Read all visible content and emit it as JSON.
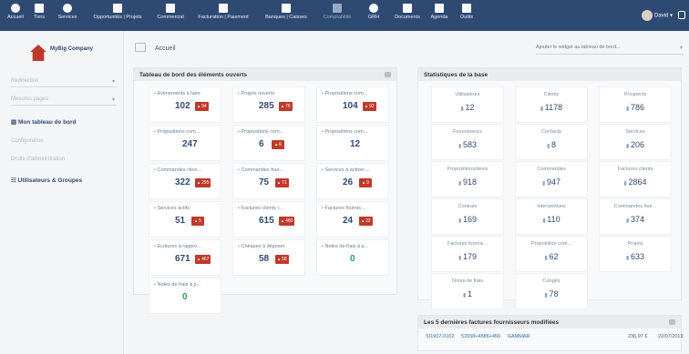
{
  "topnav": {
    "items": [
      {
        "label": "Accueil",
        "icon": "home-icon"
      },
      {
        "label": "Tiers",
        "icon": "building-icon"
      },
      {
        "label": "Services",
        "icon": "cube-icon"
      },
      {
        "label": "Opportunités | Projets",
        "icon": "sitemap-icon"
      },
      {
        "label": "Commercial",
        "icon": "suitcase-icon"
      },
      {
        "label": "Facturation | Paiement",
        "icon": "money-icon"
      },
      {
        "label": "Banques | Caisses",
        "icon": "bank-icon"
      },
      {
        "label": "Comptabilité",
        "icon": "ledger-icon"
      },
      {
        "label": "GRH",
        "icon": "user-icon"
      },
      {
        "label": "Documents",
        "icon": "folder-icon"
      },
      {
        "label": "Agenda",
        "icon": "calendar-icon"
      },
      {
        "label": "Outils",
        "icon": "wrench-icon"
      }
    ],
    "user": "David",
    "accent": "#2f4a72"
  },
  "sidebar": {
    "logo_text": "MyBig Company",
    "items": [
      "Redirection",
      "Mesures pages",
      "Mon tableau de bord",
      "Configuration",
      "Droits d'administration",
      "Utilisateurs & Groupes"
    ]
  },
  "header": {
    "breadcrumb": "Accueil",
    "search_placeholder": "Ajouter le widget au tableau de bord..."
  },
  "open_panel": {
    "title": "Tableau de bord des éléments ouverts",
    "cards": [
      {
        "label": "Événements à faire",
        "value": "102",
        "badge": "94"
      },
      {
        "label": "Projets ouverts",
        "value": "285",
        "badge": "76"
      },
      {
        "label": "Propositions com...",
        "value": "104",
        "badge": "92"
      },
      {
        "label": "Propositions com...",
        "value": "247",
        "badge": ""
      },
      {
        "label": "Propositions com...",
        "value": "6",
        "badge": "6"
      },
      {
        "label": "Propositions com...",
        "value": "12",
        "badge": ""
      },
      {
        "label": "Commandes clien...",
        "value": "322",
        "badge": "295"
      },
      {
        "label": "Commandes four...",
        "value": "75",
        "badge": "71"
      },
      {
        "label": "Services à activer ...",
        "value": "26",
        "badge": "9"
      },
      {
        "label": "Services actifs",
        "value": "51",
        "badge": "5"
      },
      {
        "label": "Factures clients i...",
        "value": "615",
        "badge": "480"
      },
      {
        "label": "Factures fournis...",
        "value": "24",
        "badge": "22"
      },
      {
        "label": "Écritures à rappro...",
        "value": "671",
        "badge": "467"
      },
      {
        "label": "Chèques à déposer",
        "value": "58",
        "badge": "58"
      },
      {
        "label": "Notes de frais à a...",
        "value": "0",
        "badge": ""
      },
      {
        "label": "Notes de frais à p...",
        "value": "0",
        "badge": ""
      }
    ]
  },
  "stats_panel": {
    "title": "Statistiques de la base",
    "stats": [
      {
        "label": "Utilisateurs",
        "value": "12"
      },
      {
        "label": "Clients",
        "value": "1178"
      },
      {
        "label": "Prospects",
        "value": "786"
      },
      {
        "label": "Fournisseurs",
        "value": "583"
      },
      {
        "label": "Contacts",
        "value": "8"
      },
      {
        "label": "Services",
        "value": "206"
      },
      {
        "label": "Propositions/devis",
        "value": "918"
      },
      {
        "label": "Commandes",
        "value": "947"
      },
      {
        "label": "Factures clients",
        "value": "2864"
      },
      {
        "label": "Contrats",
        "value": "169"
      },
      {
        "label": "Interventions",
        "value": "110"
      },
      {
        "label": "Commandes four...",
        "value": "374"
      },
      {
        "label": "Factures fournis...",
        "value": "179"
      },
      {
        "label": "Proposition com...",
        "value": "62"
      },
      {
        "label": "Projets",
        "value": "633"
      },
      {
        "label": "Notes de frais",
        "value": "1"
      },
      {
        "label": "Congés",
        "value": "78"
      }
    ]
  },
  "invoices_panel": {
    "title": "Les 5 dernières factures fournisseurs modifiées",
    "rows": [
      {
        "ref": "SI1907-0102",
        "supplier_ref": "52658+4586+456",
        "supplier": "GAMMAR",
        "amount": "236,97 €",
        "date": "22/07/2019"
      }
    ]
  }
}
